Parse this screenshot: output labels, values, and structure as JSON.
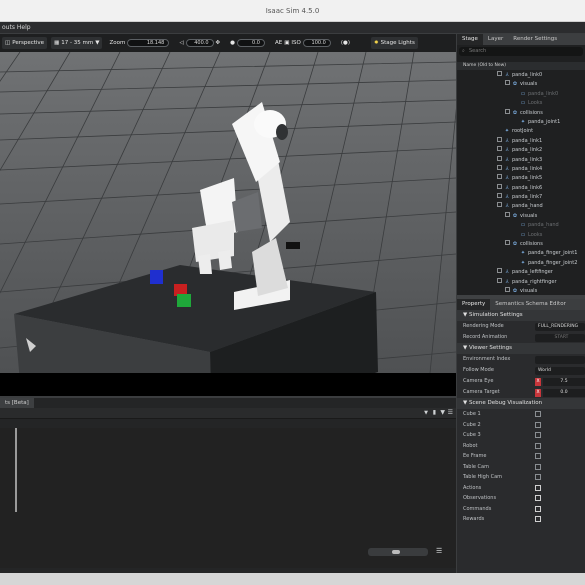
{
  "window": {
    "title": "Isaac Sim 4.5.0"
  },
  "menu": {
    "text": "outs Help"
  },
  "toolbar": {
    "perspective": "Perspective",
    "lens": "17 - 35 mm",
    "zoom_label": "Zoom",
    "zoom_value": "18.148",
    "fov_value": "400.0",
    "focus_value": "0.0",
    "ae_label": "AE",
    "iso_label": "ISO",
    "iso_value": "100.0",
    "stage_lights": "Stage Lights"
  },
  "lower_panel": {
    "tab": "ts [Beta]"
  },
  "stage": {
    "tabs": [
      "Stage",
      "Layer",
      "Render Settings"
    ],
    "search_placeholder": "Search",
    "column_header": "Name (Old to New)",
    "items": [
      {
        "label": "panda_link0",
        "dim": false
      },
      {
        "label": "visuals",
        "dim": false
      },
      {
        "label": "panda_link0",
        "dim": true
      },
      {
        "label": "Looks",
        "dim": true
      },
      {
        "label": "collisions",
        "dim": false
      },
      {
        "label": "panda_joint1",
        "dim": false
      },
      {
        "label": "rootJoint",
        "dim": false
      },
      {
        "label": "panda_link1",
        "dim": false
      },
      {
        "label": "panda_link2",
        "dim": false
      },
      {
        "label": "panda_link3",
        "dim": false
      },
      {
        "label": "panda_link4",
        "dim": false
      },
      {
        "label": "panda_link5",
        "dim": false
      },
      {
        "label": "panda_link6",
        "dim": false
      },
      {
        "label": "panda_link7",
        "dim": false
      },
      {
        "label": "panda_hand",
        "dim": false
      },
      {
        "label": "visuals",
        "dim": false
      },
      {
        "label": "panda_hand",
        "dim": true
      },
      {
        "label": "Looks",
        "dim": true
      },
      {
        "label": "collisions",
        "dim": false
      },
      {
        "label": "panda_finger_joint1",
        "dim": false
      },
      {
        "label": "panda_finger_joint2",
        "dim": false
      },
      {
        "label": "panda_leftfinger",
        "dim": false
      },
      {
        "label": "panda_rightfinger",
        "dim": false
      },
      {
        "label": "visuals",
        "dim": false
      }
    ]
  },
  "property": {
    "tabs": [
      "Property",
      "Semantics Schema Editor"
    ],
    "sim_header": "Simulation Settings",
    "rendering_mode_label": "Rendering Mode",
    "rendering_mode_value": "FULL_RENDERING",
    "record_label": "Record Animation",
    "record_button": "START",
    "viewer_header": "Viewer Settings",
    "env_index_label": "Environment Index",
    "follow_mode_label": "Follow Mode",
    "follow_mode_value": "World",
    "cam_eye_label": "Camera Eye",
    "cam_eye_axis": "X",
    "cam_eye_value": "7.5",
    "cam_target_label": "Camera Target",
    "cam_target_axis": "X",
    "cam_target_value": "0.0",
    "debug_header": "Scene Debug Visualization",
    "debug_items": [
      "Cube 1",
      "Cube 2",
      "Cube 3",
      "Robot",
      "Ee Frame",
      "Table Cam",
      "Table High Cam",
      "Actions",
      "Observations",
      "Commands",
      "Rewards"
    ]
  },
  "colors": {
    "accent": "#76b900",
    "cube_blue": "#1f2fcf",
    "cube_red": "#c82020",
    "cube_green": "#1fa83a"
  }
}
